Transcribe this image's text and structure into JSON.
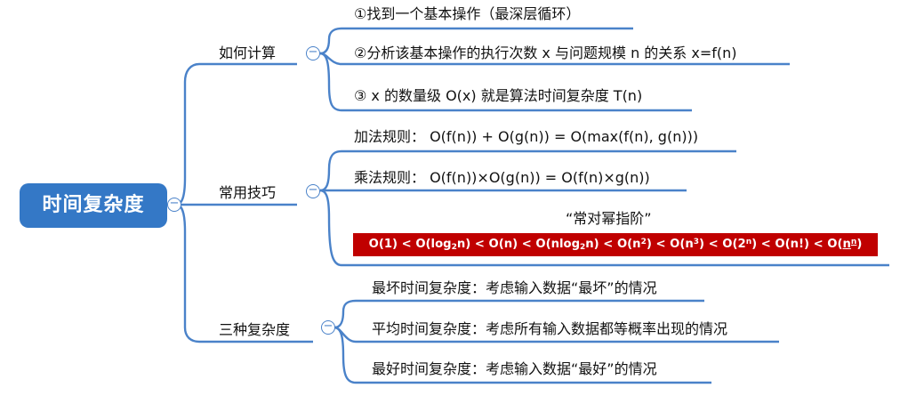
{
  "root": {
    "label": "时间复杂度"
  },
  "branches": [
    {
      "label": "如何计算",
      "items": [
        "①找到一个基本操作（最深层循环）",
        "②分析该基本操作的执行次数 x 与问题规模 n 的关系 x=f(n)",
        "③ x 的数量级 O(x) 就是算法时间复杂度 T(n)"
      ]
    },
    {
      "label": "常用技巧",
      "items": [
        "加法规则：  O(f(n)) + O(g(n)) = O(max(f(n), g(n)))",
        "乘法规则：  O(f(n))×O(g(n)) = O(f(n)×g(n))"
      ],
      "highlight": {
        "title": "“常对幂指阶”",
        "order": {
          "t1": "O(1) < O(log",
          "s1": "2",
          "t2": "n) < O(n) < O(nlog",
          "s2": "2",
          "t3": "n) < O(n",
          "p1": "2",
          "t4": ")  < O(n",
          "p2": "3",
          "t5": ") < O(2",
          "p3": "n",
          "t6": ") < O(n!) < O(",
          "nb": "n",
          "p4": "n",
          "t7": ")"
        },
        "color": "#c00000"
      }
    },
    {
      "label": "三种复杂度",
      "items": [
        "最坏时间复杂度：考虑输入数据“最坏”的情况",
        "平均时间复杂度：考虑所有输入数据都等概率出现的情况",
        "最好时间复杂度：考虑输入数据“最好”的情况"
      ]
    }
  ],
  "colors": {
    "root": "#3478c6",
    "line": "#4a82c9",
    "highlight": "#c00000"
  }
}
